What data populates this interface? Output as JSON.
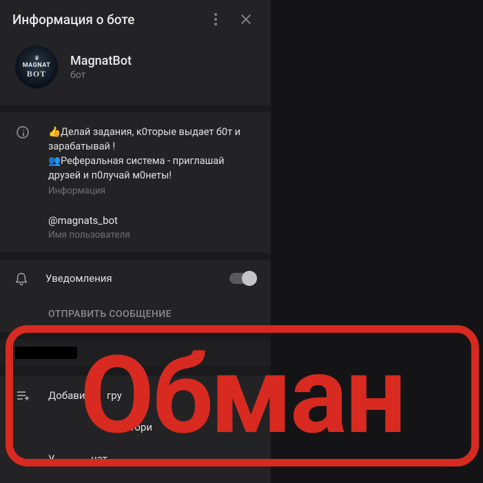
{
  "header": {
    "title": "Информация о боте"
  },
  "profile": {
    "name": "MagnatBot",
    "subtitle": "бот",
    "avatar_line1": "MAGNAT",
    "avatar_line2": "BOT"
  },
  "bio": {
    "line1": "👍Делай задания, к0торые выдает б0т и зарабатывай !",
    "line2": "👥Реферальная система - приглашай друзей и п0лучай м0неты!",
    "caption": "Информация"
  },
  "username": {
    "value": "@magnats_bot",
    "caption": "Имя пользователя"
  },
  "notifications": {
    "label": "Уведомления"
  },
  "send_message": "ОТПРАВИТЬ СООБЩЕНИЕ",
  "actions": {
    "add_to_group_prefix": "Добавит",
    "add_to_group_suffix": "гру",
    "history_suffix": "истори",
    "delete_prefix": "У",
    "delete_suffix": "чат"
  },
  "stamp": "Обман"
}
